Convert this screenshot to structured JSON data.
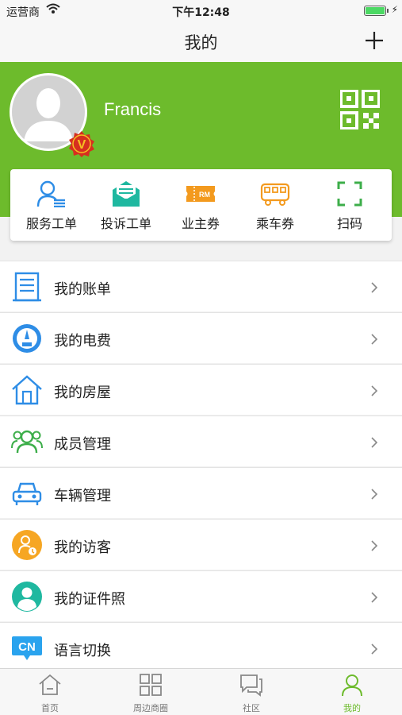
{
  "status_bar": {
    "carrier": "运营商",
    "time": "下午12:48"
  },
  "nav": {
    "title": "我的"
  },
  "profile": {
    "username": "Francis",
    "badge_letter": "V"
  },
  "quick_actions": [
    {
      "label": "服务工单",
      "icon": "service-order-icon"
    },
    {
      "label": "投诉工单",
      "icon": "complaint-order-icon"
    },
    {
      "label": "业主券",
      "icon": "owner-coupon-icon"
    },
    {
      "label": "乘车券",
      "icon": "bus-ticket-icon"
    },
    {
      "label": "扫码",
      "icon": "scan-icon"
    }
  ],
  "menu": [
    {
      "label": "我的账单",
      "icon": "bill-icon"
    },
    {
      "label": "我的电费",
      "icon": "electric-meter-icon"
    },
    {
      "label": "我的房屋",
      "icon": "house-icon"
    },
    {
      "label": "成员管理",
      "icon": "members-icon"
    },
    {
      "label": "车辆管理",
      "icon": "car-icon"
    },
    {
      "label": "我的访客",
      "icon": "visitor-icon"
    },
    {
      "label": "我的证件照",
      "icon": "id-photo-icon"
    },
    {
      "label": "语言切换",
      "icon": "language-icon",
      "icon_text": "CN"
    }
  ],
  "tabs": [
    {
      "label": "首页",
      "icon": "home-icon"
    },
    {
      "label": "周边商圈",
      "icon": "grid-icon"
    },
    {
      "label": "社区",
      "icon": "chat-icon"
    },
    {
      "label": "我的",
      "icon": "profile-icon",
      "active": true
    }
  ],
  "colors": {
    "brand_green": "#6dbb2c",
    "blue": "#2e8de6",
    "teal": "#1fb8a0",
    "orange": "#f39a1e",
    "green": "#3dae4a"
  }
}
